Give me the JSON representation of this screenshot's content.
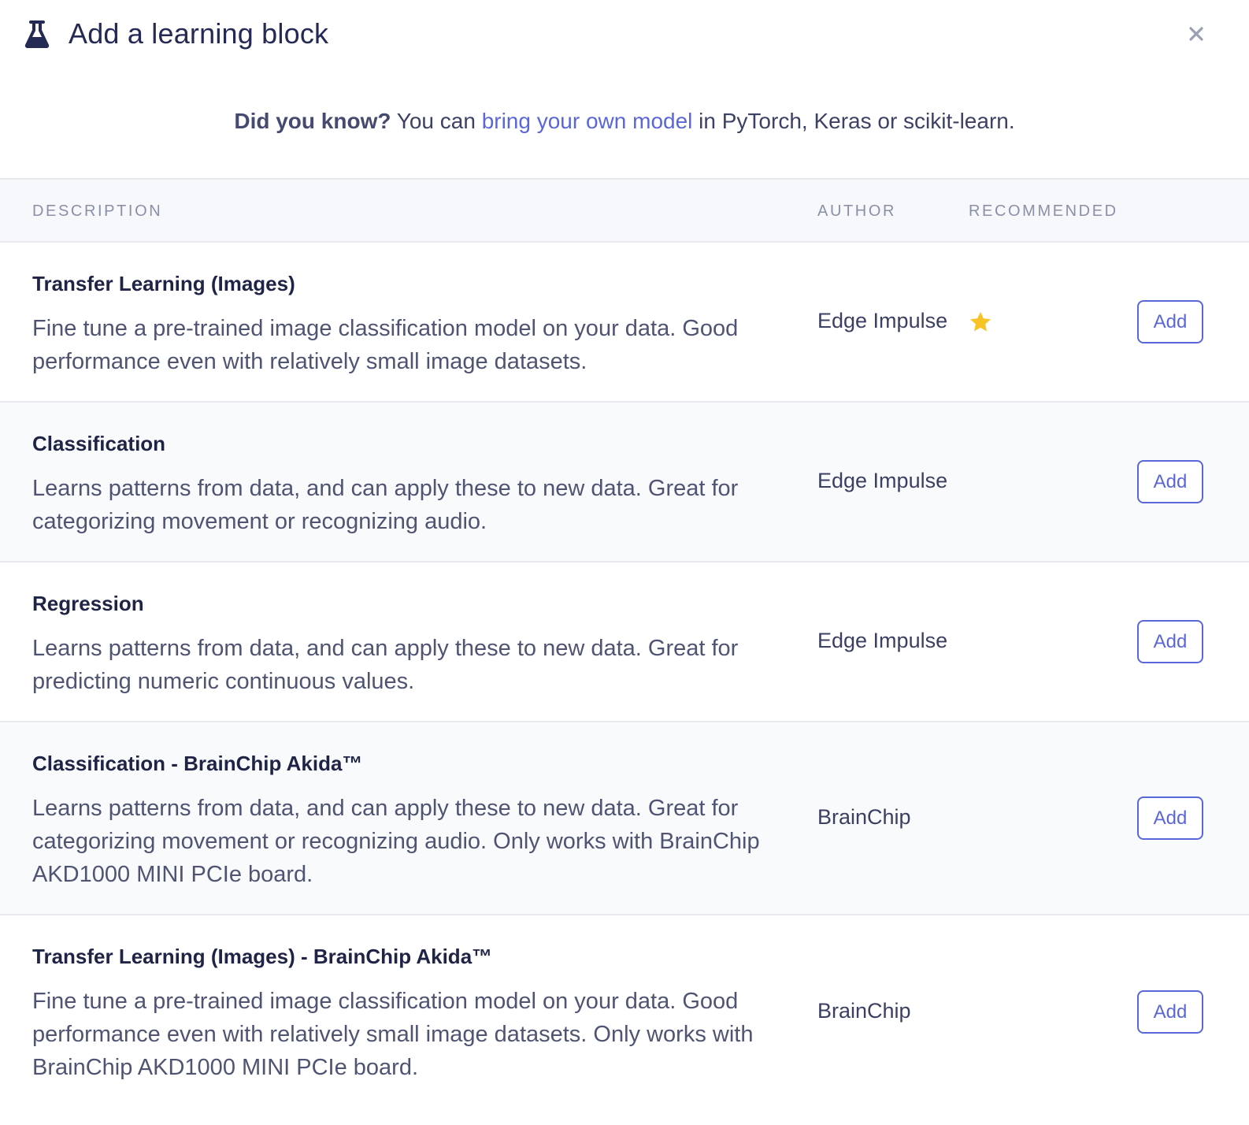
{
  "modal": {
    "title": "Add a learning block",
    "tip": {
      "bold": "Did you know?",
      "before_link": " You can ",
      "link": "bring your own model",
      "after_link": " in PyTorch, Keras or scikit-learn."
    }
  },
  "table": {
    "headers": {
      "description": "DESCRIPTION",
      "author": "AUTHOR",
      "recommended": "RECOMMENDED"
    },
    "rows": [
      {
        "name": "Transfer Learning (Images)",
        "description": "Fine tune a pre-trained image classification model on your data. Good performance even with relatively small image datasets.",
        "author": "Edge Impulse",
        "recommended": true,
        "action": "Add"
      },
      {
        "name": "Classification",
        "description": "Learns patterns from data, and can apply these to new data. Great for categorizing movement or recognizing audio.",
        "author": "Edge Impulse",
        "recommended": false,
        "action": "Add"
      },
      {
        "name": "Regression",
        "description": "Learns patterns from data, and can apply these to new data. Great for predicting numeric continuous values.",
        "author": "Edge Impulse",
        "recommended": false,
        "action": "Add"
      },
      {
        "name": "Classification - BrainChip Akida™",
        "description": "Learns patterns from data, and can apply these to new data. Great for categorizing movement or recognizing audio. Only works with BrainChip AKD1000 MINI PCIe board.",
        "author": "BrainChip",
        "recommended": false,
        "action": "Add"
      },
      {
        "name": "Transfer Learning (Images) - BrainChip Akida™",
        "description": "Fine tune a pre-trained image classification model on your data. Good performance even with relatively small image datasets. Only works with BrainChip AKD1000 MINI PCIe board.",
        "author": "BrainChip",
        "recommended": false,
        "action": "Add"
      }
    ]
  },
  "colors": {
    "accent": "#5a67d8",
    "title": "#252a55",
    "star": "#f7c325",
    "header_bg": "#f7f8fb"
  },
  "icons": {
    "title_icon": "flask-icon",
    "close_icon": "close-icon",
    "recommended_icon": "star-icon"
  }
}
